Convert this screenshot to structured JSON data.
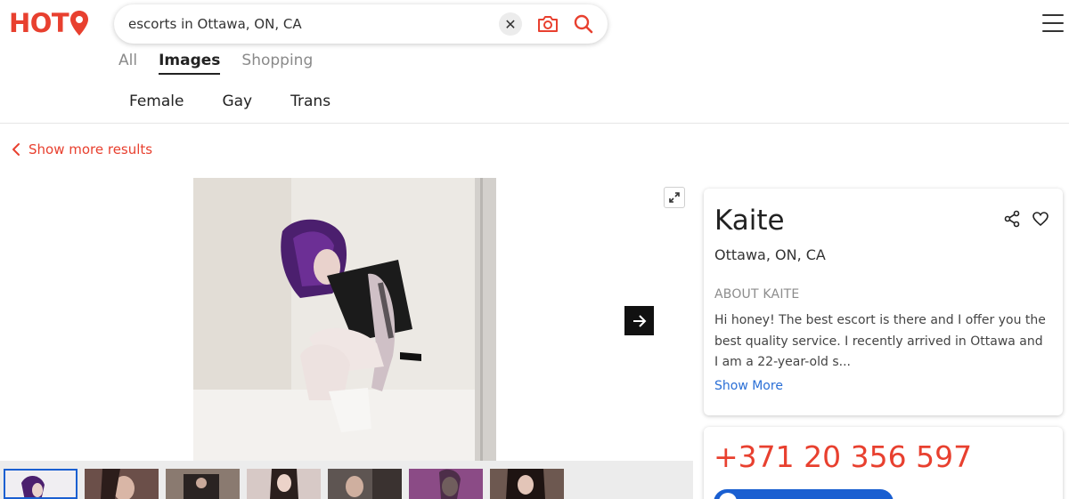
{
  "header": {
    "logo_text": "HOT",
    "search": {
      "value": "escorts in Ottawa, ON, CA"
    },
    "icons": [
      "clear-icon",
      "camera-icon",
      "search-icon",
      "hamburger-menu-icon"
    ]
  },
  "tabs": [
    {
      "label": "All",
      "active": false
    },
    {
      "label": "Images",
      "active": true
    },
    {
      "label": "Shopping",
      "active": false
    }
  ],
  "filters": [
    "Female",
    "Gay",
    "Trans"
  ],
  "back_link": {
    "label": "Show more results"
  },
  "profile": {
    "name": "Kaite",
    "location": "Ottawa, ON, CA",
    "about_heading": "ABOUT KAITE",
    "about_text": "Hi honey! The best escort is there and I offer you the best quality service. I recently arrived in Ottawa and I am a 22-year-old s...",
    "show_more": "Show More",
    "phone": "+371 20 356 597"
  },
  "colors": {
    "brand": "#e8402f",
    "link": "#2a6fd6",
    "call_button": "#1a5fd1"
  }
}
